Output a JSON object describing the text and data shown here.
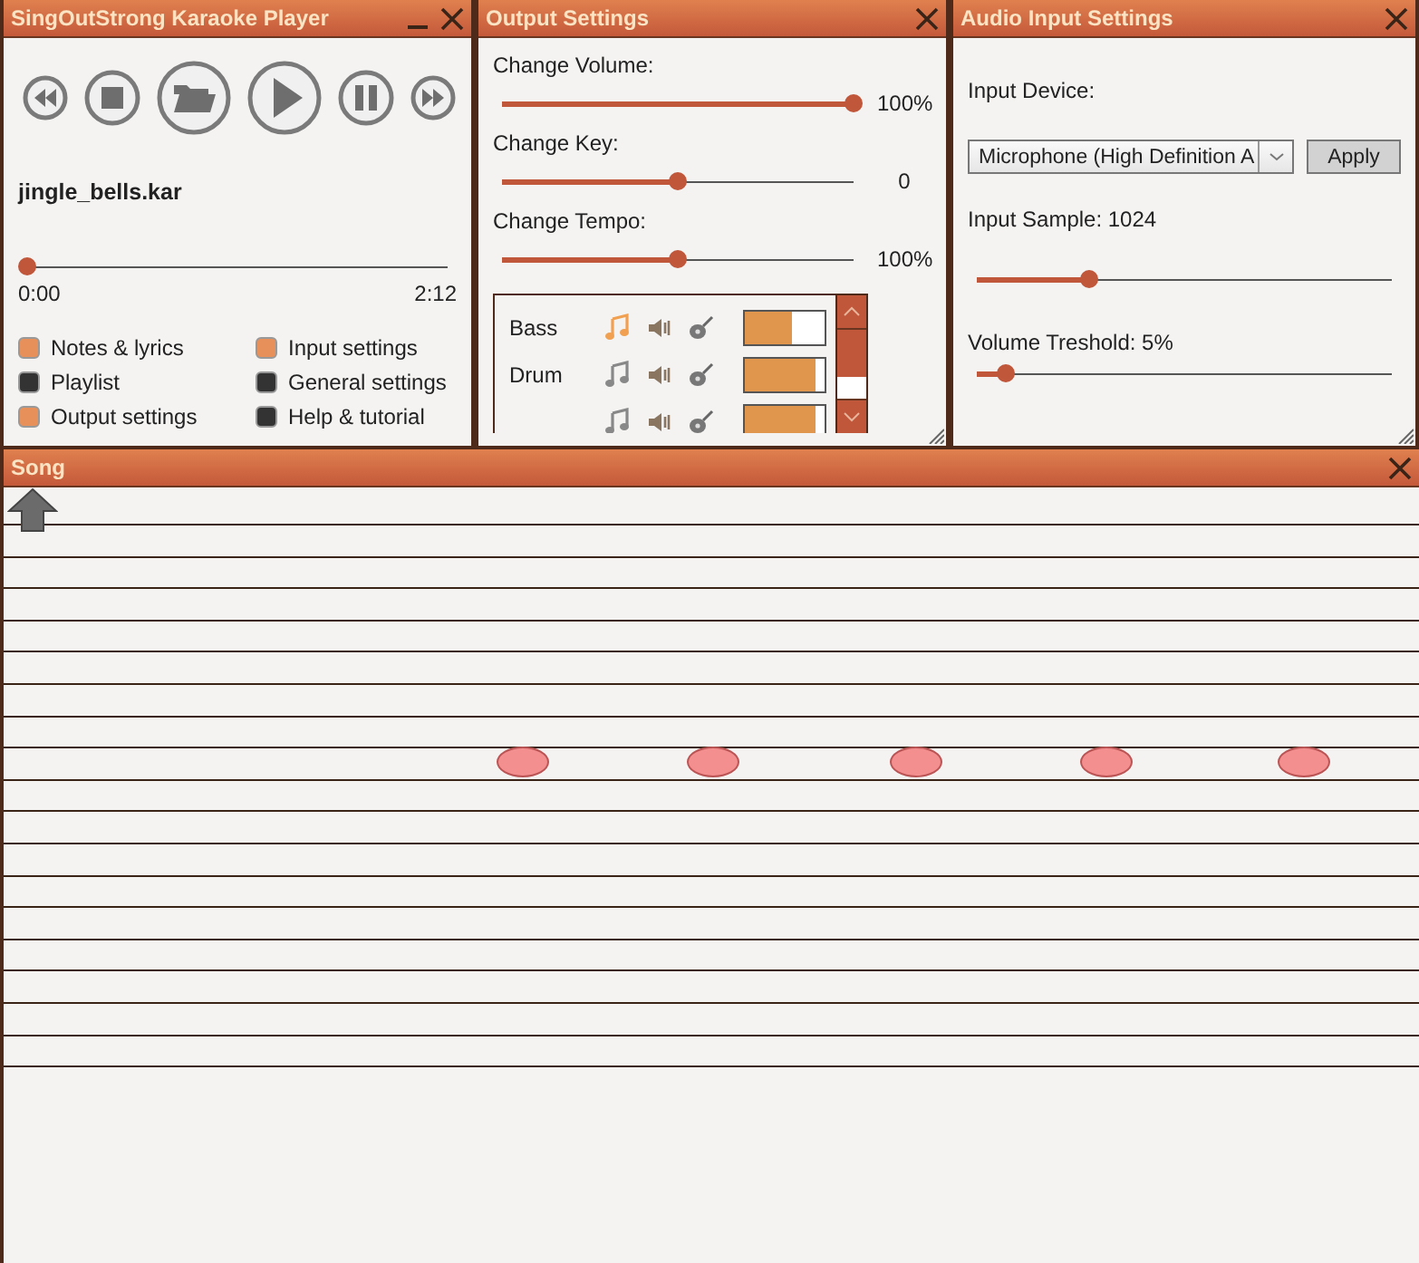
{
  "player": {
    "title": "SingOutStrong Karaoke Player",
    "file": "jingle_bells.kar",
    "position": {
      "level": 0
    },
    "elapsed": "0:00",
    "duration": "2:12",
    "toggles": [
      {
        "label": "Notes & lyrics",
        "checked": true
      },
      {
        "label": "Input settings",
        "checked": true
      },
      {
        "label": "Playlist",
        "checked": false
      },
      {
        "label": "General settings",
        "checked": false
      },
      {
        "label": "Output settings",
        "checked": true
      },
      {
        "label": "Help & tutorial",
        "checked": false
      }
    ]
  },
  "output": {
    "title": "Output Settings",
    "sliders": [
      {
        "label": "Change Volume:",
        "level": 1,
        "reading": "100%"
      },
      {
        "label": "Change Key:",
        "level": 0.5,
        "reading": "0"
      },
      {
        "label": "Change Tempo:",
        "level": 0.5,
        "reading": "100%"
      }
    ],
    "tracks": [
      {
        "name": "Bass",
        "active": true,
        "level": 0.58
      },
      {
        "name": "Drum",
        "active": false,
        "level": 0.88
      },
      {
        "active": false,
        "level": 0.88
      }
    ]
  },
  "input": {
    "title": "Audio Input Settings",
    "device_label": "Input Device:",
    "device": "Microphone (High Definition A",
    "apply": "Apply",
    "sample": {
      "label": "Input Sample: 1024",
      "level": 0.27
    },
    "threshold": {
      "label": "Volume Treshold: 5%",
      "level": 0.07
    }
  },
  "song": {
    "title": "Song"
  }
}
